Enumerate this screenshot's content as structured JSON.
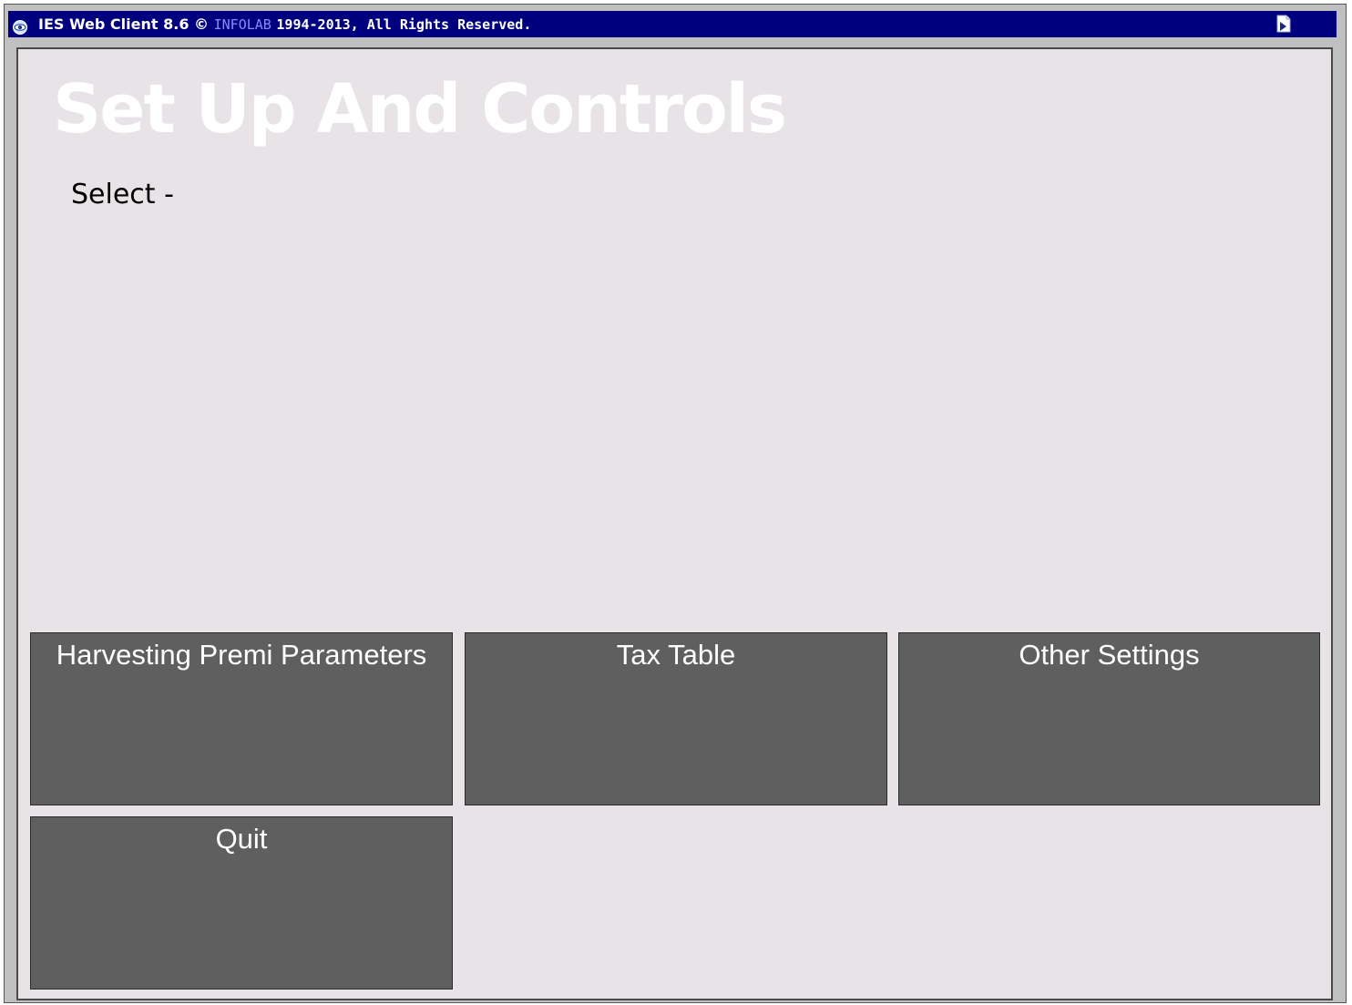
{
  "window": {
    "app_name": "IES Web Client 8.6",
    "copyright_symbol": "©",
    "brand": "INFOLAB",
    "rights": "1994-2013, All Rights Reserved.",
    "app_icon": "eye-globe-icon",
    "corner_icon": "document-arrow-icon",
    "title_bar_color": "#00007f",
    "panel_color": "#e7e3e7",
    "button_color": "#5f5f5f"
  },
  "page": {
    "title": "Set Up And Controls",
    "prompt": "Select -"
  },
  "menu": {
    "harvesting": "Harvesting Premi Parameters",
    "tax_table": "Tax Table",
    "other_settings": "Other Settings",
    "quit": "Quit"
  }
}
